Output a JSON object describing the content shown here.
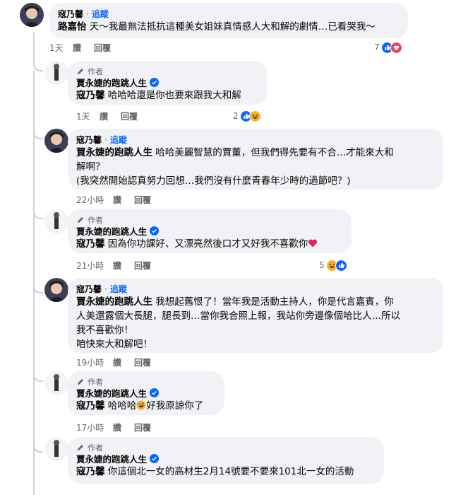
{
  "comments": [
    {
      "commenter": "寇乃馨",
      "follow": "追蹤",
      "mention": "路嘉怡",
      "lines": [
        "天～我最無法抵抗這種美女姐妹真情感人大和解的劇情…已看哭我～"
      ],
      "time": "1天",
      "like": "讚",
      "reply": "回覆",
      "reaction_count": "7",
      "reactions": [
        "like",
        "love"
      ]
    },
    {
      "author_badge": "作者",
      "commenter": "賈永婕的跑跳人生",
      "mention": "寇乃馨",
      "lines": [
        "哈哈哈還是你也要來跟我大和解"
      ],
      "time": "1天",
      "like": "讚",
      "reply": "回覆",
      "reaction_count": "2",
      "reactions": [
        "like",
        "haha"
      ]
    },
    {
      "commenter": "寇乃馨",
      "follow": "追蹤",
      "mention": "賈永婕的跑跳人生",
      "lines": [
        "哈哈美麗智慧的賈董，但我們得先要有不合…才能來大和",
        "解啊？",
        "(我突然開始認真努力回想…我們沒有什麼青春年少時的過節吧？)"
      ],
      "time": "22小時",
      "like": "讚",
      "reply": "回覆"
    },
    {
      "author_badge": "作者",
      "commenter": "賈永婕的跑跳人生",
      "mention": "寇乃馨",
      "lines": [
        "因為你功課好、又漂亮然後口才又好我不喜歡你"
      ],
      "time": "21小時",
      "like": "讚",
      "reply": "回覆",
      "reaction_count": "5",
      "reactions": [
        "haha",
        "like"
      ]
    },
    {
      "commenter": "寇乃馨",
      "follow": "追蹤",
      "mention": "賈永婕的跑跳人生",
      "lines": [
        "我想起舊恨了！當年我是活動主持人，你是代言嘉賓，你",
        "人美還露個大長腿，腿長到…當你我合照上報，我站你旁邊像個哈比人…所以",
        "我不喜歡你！",
        "咱快來大和解吧！"
      ],
      "time": "19小時",
      "like": "讚",
      "reply": "回覆"
    },
    {
      "author_badge": "作者",
      "commenter": "賈永婕的跑跳人生",
      "mention": "寇乃馨",
      "lines": [
        "哈哈哈",
        "好我原諒你了"
      ],
      "time": "17小時",
      "like": "讚",
      "reply": "回覆"
    },
    {
      "author_badge": "作者",
      "commenter": "賈永婕的跑跳人生",
      "mention": "寇乃馨",
      "lines": [
        "你這個北一女的高材生2月14號要不要來101北一女的活動"
      ]
    }
  ],
  "colors": {
    "bubble": "#f0f2f5",
    "link_blue": "#0866ff",
    "meta_gray": "#65676b",
    "like_blue": "#0866ff",
    "love_red": "#f33e58",
    "haha_yellow": "#f7b125"
  },
  "icons": {
    "verified": "verified-badge-icon",
    "author": "pen-icon",
    "like": "like-reaction-icon",
    "love": "love-reaction-icon",
    "haha": "haha-reaction-icon",
    "heart": "red-heart-emoji",
    "rofl": "rofl-emoji"
  }
}
